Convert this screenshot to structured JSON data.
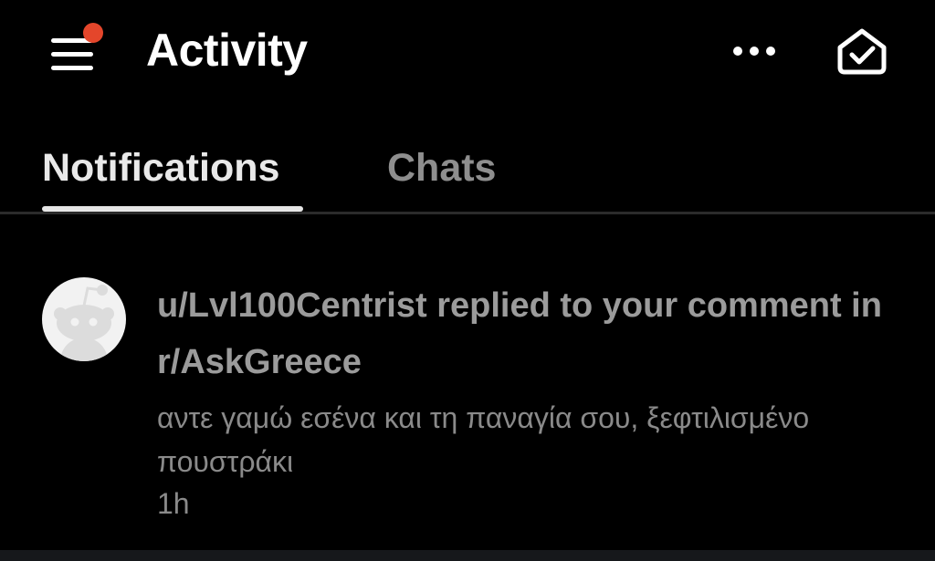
{
  "header": {
    "title": "Activity",
    "icons": {
      "menu": "hamburger-menu-icon",
      "more": "more-dots-icon",
      "inbox": "mark-read-icon"
    },
    "badge_color": "#e4462b"
  },
  "tabs": [
    {
      "label": "Notifications",
      "active": true
    },
    {
      "label": "Chats",
      "active": false
    }
  ],
  "notifications": [
    {
      "avatar": "reddit-snoo-avatar-icon",
      "title": "u/Lvl100Centrist replied to your comment in r/AskGreece",
      "body": "αντε γαμώ εσένα και τη παναγία σου, ξεφτιλισμένο πουστράκι",
      "time": "1h"
    }
  ],
  "colors": {
    "background": "#000000",
    "title": "#ffffff",
    "active_tab": "#e9e9e9",
    "inactive_tab": "#8e8e8e",
    "notification_text": "#9b9b9b"
  }
}
